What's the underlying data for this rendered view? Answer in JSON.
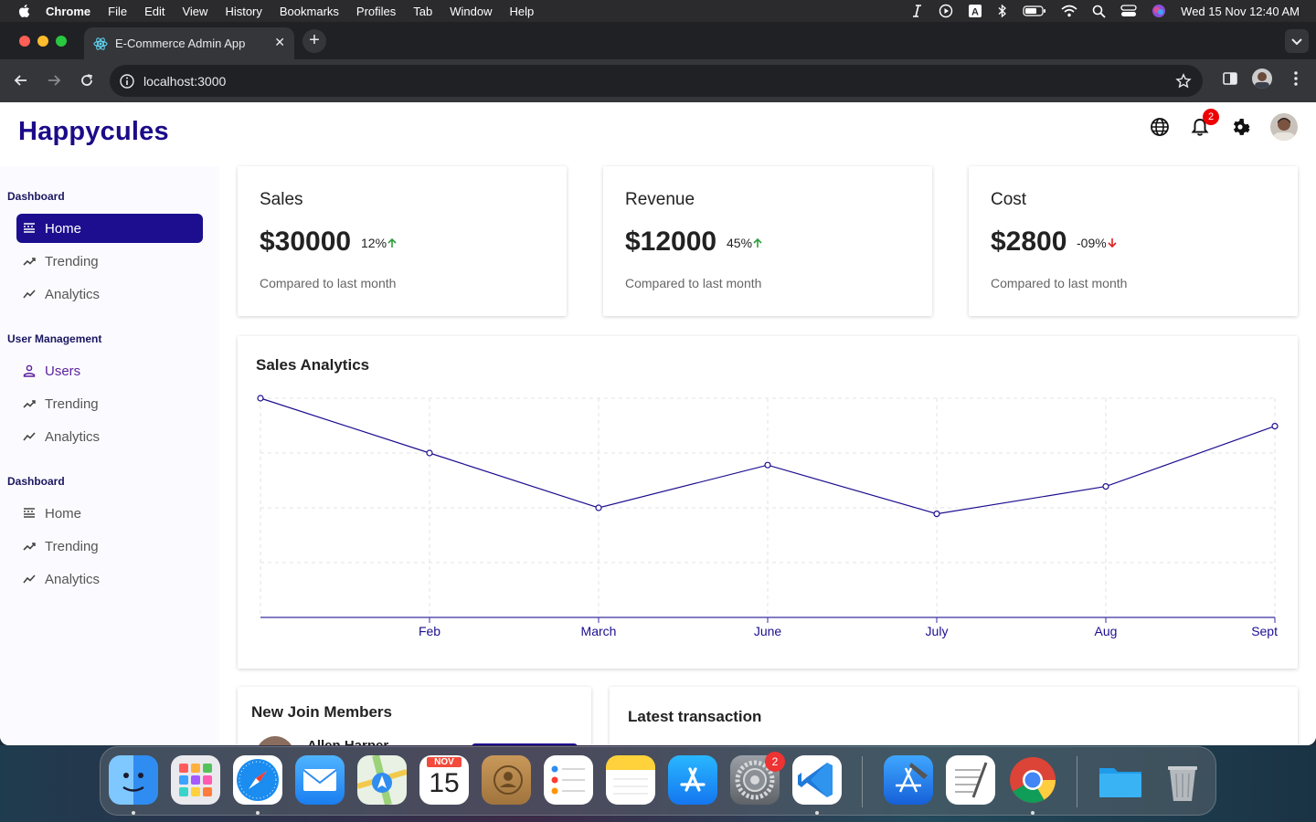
{
  "menubar": {
    "app_name": "Chrome",
    "items": [
      "File",
      "Edit",
      "View",
      "History",
      "Bookmarks",
      "Profiles",
      "Tab",
      "Window",
      "Help"
    ],
    "datetime": "Wed 15 Nov  12:40 AM"
  },
  "browser": {
    "tab_title": "E-Commerce Admin App",
    "url": "localhost:3000"
  },
  "app": {
    "logo": "Happycules",
    "notification_count": "2"
  },
  "sidebar": {
    "sections": [
      {
        "title": "Dashboard",
        "items": [
          "Home",
          "Trending",
          "Analytics"
        ]
      },
      {
        "title": "User Management",
        "items": [
          "Users",
          "Trending",
          "Analytics"
        ]
      },
      {
        "title": "Dashboard",
        "items": [
          "Home",
          "Trending",
          "Analytics"
        ]
      }
    ]
  },
  "kpis": [
    {
      "title": "Sales",
      "value": "$30000",
      "rate": "12%",
      "trend": "up",
      "sub": "Compared to last month"
    },
    {
      "title": "Revenue",
      "value": "$12000",
      "rate": "45%",
      "trend": "up",
      "sub": "Compared to last month"
    },
    {
      "title": "Cost",
      "value": "$2800",
      "rate": "-09%",
      "trend": "down",
      "sub": "Compared to last month"
    }
  ],
  "colors": {
    "primary": "#1c0e8f",
    "up": "#2e9e3a",
    "down": "#e02020"
  },
  "chart_data": {
    "type": "line",
    "title": "Sales Analytics",
    "categories": [
      "",
      "Feb",
      "March",
      "June",
      "July",
      "Aug",
      "Sept"
    ],
    "series": [
      {
        "values": [
          4000,
          3000,
          2000,
          2780,
          1890,
          2390,
          3490
        ]
      }
    ],
    "ylim": [
      0,
      4000
    ],
    "grid": true,
    "color": "#1c0e8f"
  },
  "widgets": {
    "members_title": "New Join Members",
    "member_name": "Allen Harper",
    "transactions_title": "Latest transaction"
  },
  "dock": {
    "calendar_month": "NOV",
    "calendar_day": "15",
    "settings_badge": "2"
  }
}
